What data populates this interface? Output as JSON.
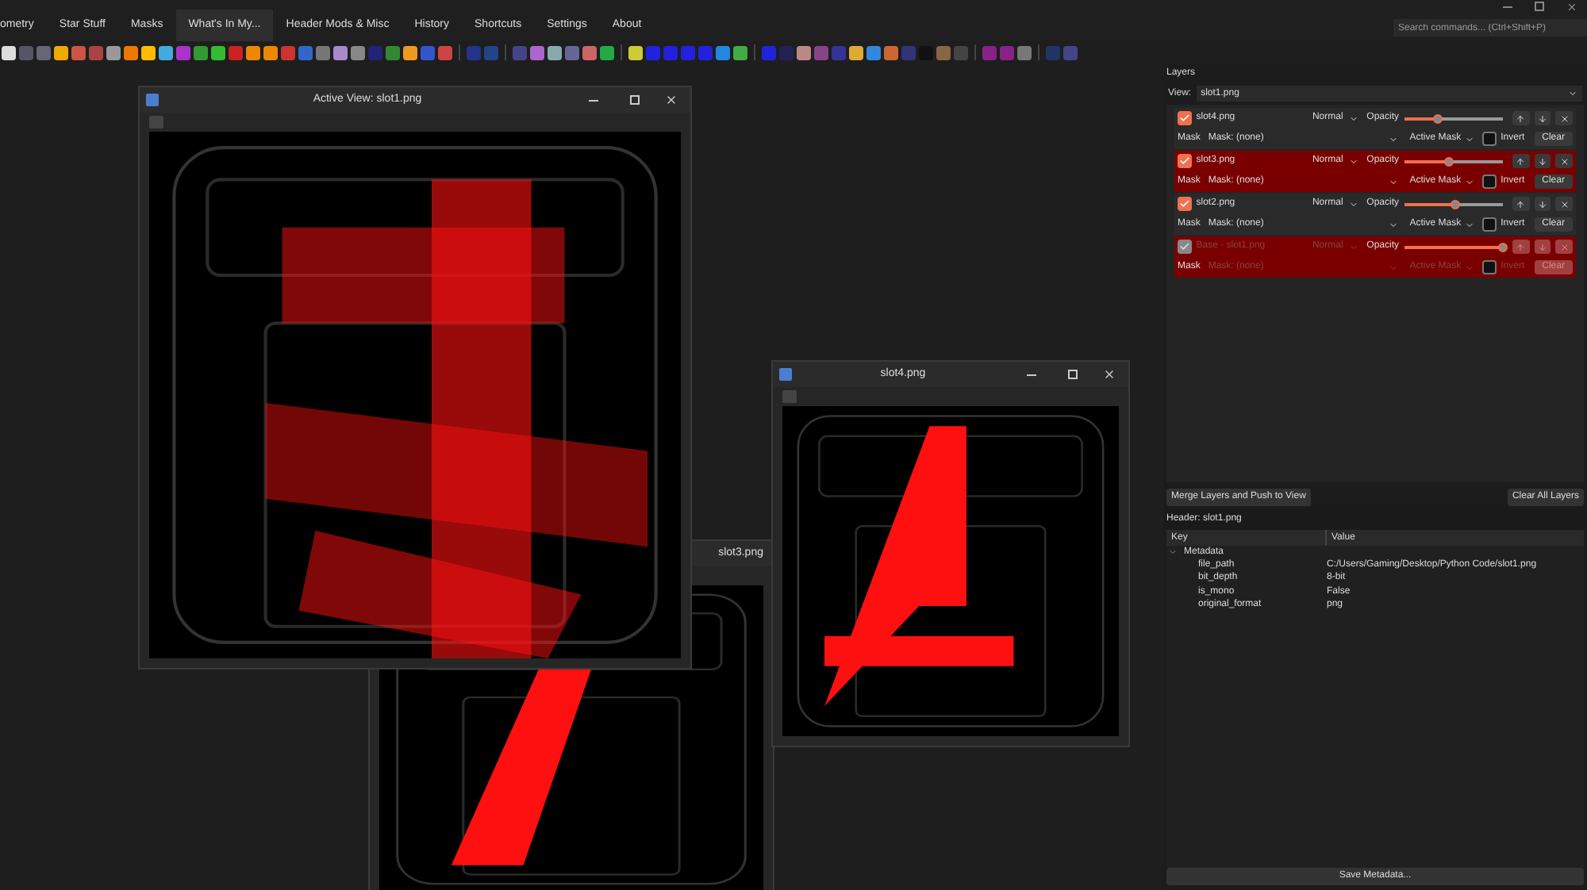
{
  "menu": [
    {
      "label": "ometry",
      "selected": false
    },
    {
      "label": "Star Stuff",
      "selected": false
    },
    {
      "label": "Masks",
      "selected": false
    },
    {
      "label": "What's In My...",
      "selected": true
    },
    {
      "label": "Header Mods & Misc",
      "selected": false
    },
    {
      "label": "History",
      "selected": false
    },
    {
      "label": "Shortcuts",
      "selected": false
    },
    {
      "label": "Settings",
      "selected": false
    },
    {
      "label": "About",
      "selected": false
    }
  ],
  "search": {
    "placeholder": "Search commands... (Ctrl+Shift+P)"
  },
  "windows": [
    {
      "title": "slot3.png",
      "kind": "picture"
    },
    {
      "title": "Active View: slot1.png",
      "kind": "picture"
    },
    {
      "title": "slot4.png",
      "kind": "picture"
    }
  ],
  "layers": {
    "title": "Layers",
    "view_label": "View:",
    "view_value": "slot1.png",
    "items": [
      {
        "name": "slot4.png",
        "checked": true,
        "selected": false,
        "disabled": false,
        "blend": "Normal",
        "opacity_label": "Opacity",
        "level": 0.35,
        "mask_label": "Mask",
        "mask": "Mask: (none)",
        "mask_mode": "Active Mask",
        "invert_label": "Invert",
        "invert": false,
        "clear": "Clear"
      },
      {
        "name": "slot3.png",
        "checked": true,
        "selected": true,
        "disabled": false,
        "blend": "Normal",
        "opacity_label": "Opacity",
        "level": 0.45,
        "mask_label": "Mask",
        "mask": "Mask: (none)",
        "mask_mode": "Active Mask",
        "invert_label": "Invert",
        "invert": false,
        "clear": "Clear"
      },
      {
        "name": "slot2.png",
        "checked": true,
        "selected": false,
        "disabled": false,
        "blend": "Normal",
        "opacity_label": "Opacity",
        "level": 0.52,
        "mask_label": "Mask",
        "mask": "Mask: (none)",
        "mask_mode": "Active Mask",
        "invert_label": "Invert",
        "invert": false,
        "clear": "Clear"
      },
      {
        "name": "Base - slot1.png",
        "checked": true,
        "selected": true,
        "disabled": true,
        "blend": "Normal",
        "opacity_label": "Opacity",
        "level": 1,
        "mask_label": "Mask",
        "mask": "Mask: (none)",
        "mask_mode": "Active Mask",
        "invert_label": "Invert",
        "invert": false,
        "clear": "Clear"
      }
    ],
    "merge_button": "Merge Layers and Push to View",
    "clear_all_button": "Clear All Layers"
  },
  "header": {
    "title": "Header: slot1.png",
    "columns": [
      "Key",
      "Value"
    ],
    "rows": [
      {
        "key": "Metadata",
        "value": "",
        "expanded": true,
        "children": [
          {
            "key": "file_path",
            "value": "C:/Users/Gaming/Desktop/Python Code/slot1.png"
          },
          {
            "key": "bit_depth",
            "value": "8-bit"
          },
          {
            "key": "is_mono",
            "value": "False"
          },
          {
            "key": "original_format",
            "value": "png"
          }
        ]
      }
    ],
    "save_button": "Save Metadata..."
  }
}
